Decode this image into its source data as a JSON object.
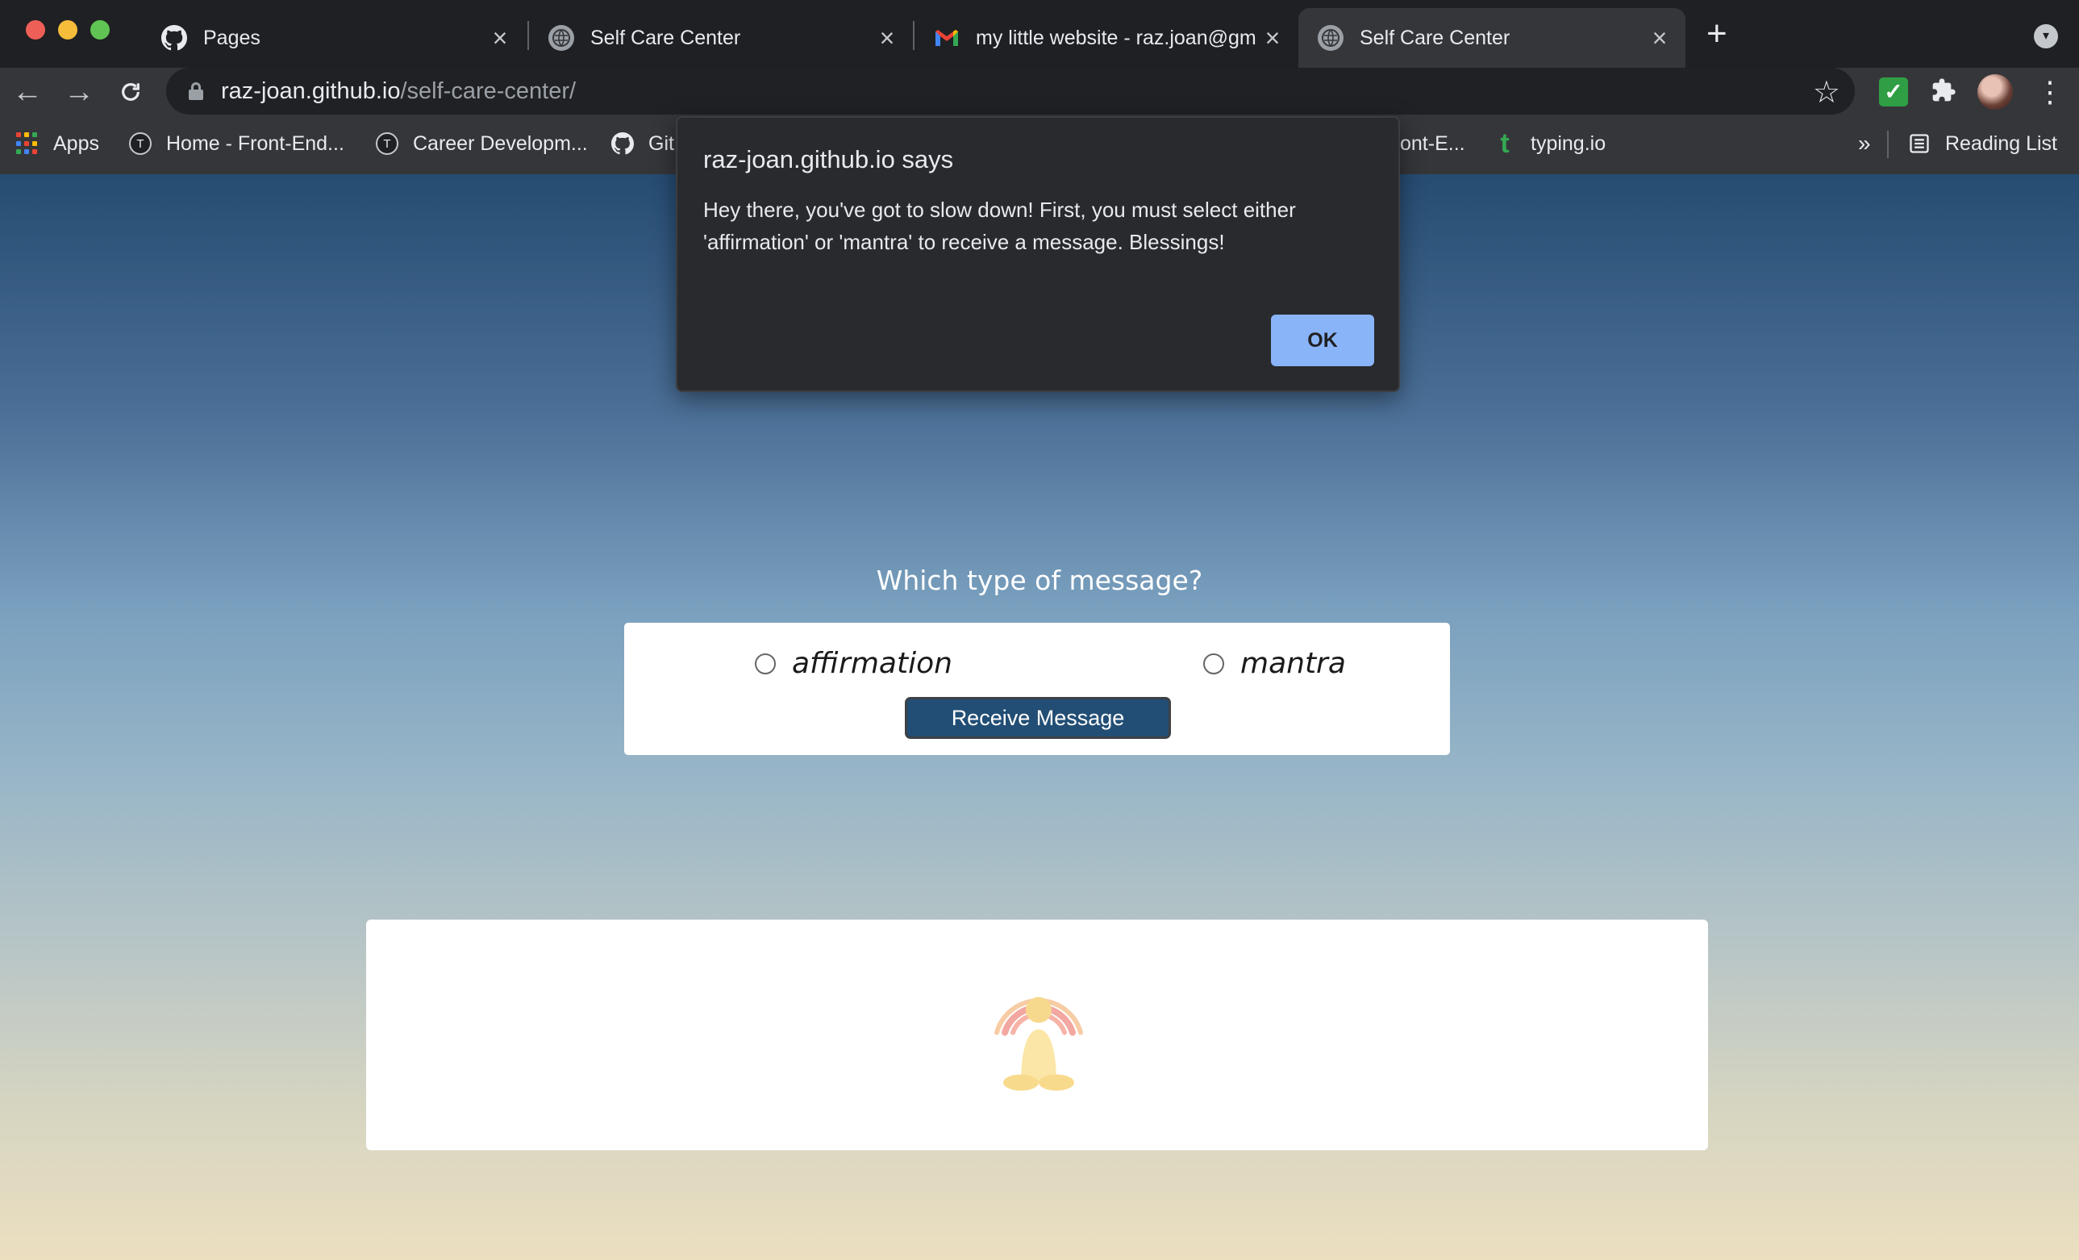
{
  "browser": {
    "tabs": [
      {
        "label": "Pages",
        "icon": "github-icon",
        "active": false
      },
      {
        "label": "Self Care Center",
        "icon": "globe-icon",
        "active": false
      },
      {
        "label": "my little website - raz.joan@gm",
        "icon": "gmail-icon",
        "active": false
      },
      {
        "label": "Self Care Center",
        "icon": "globe-icon",
        "active": true
      }
    ],
    "url_host": "raz-joan.github.io",
    "url_path": "/self-care-center/",
    "bookmarks": [
      {
        "label": "Apps",
        "icon": "apps-grid-icon"
      },
      {
        "label": "Home - Front-End...",
        "icon": "turing-icon"
      },
      {
        "label": "Career Developm...",
        "icon": "turing-icon"
      },
      {
        "label": "Git",
        "icon": "github-icon"
      },
      {
        "label": "ont-E...",
        "icon": ""
      },
      {
        "label": "typing.io",
        "icon": "typing-icon"
      }
    ],
    "overflow_label": "»",
    "reading_list_label": "Reading List"
  },
  "page": {
    "question": "Which type of message?",
    "options": [
      {
        "label": "affirmation",
        "selected": false
      },
      {
        "label": "mantra",
        "selected": false
      }
    ],
    "receive_button_label": "Receive Message",
    "message_icon": "meditation-icon"
  },
  "alert": {
    "title": "raz-joan.github.io says",
    "message": "Hey there, you've got to slow down! First, you must select either 'affirmation' or 'mantra' to receive a message. Blessings!",
    "ok_label": "OK"
  },
  "colors": {
    "button_bg": "#224e75",
    "ok_button": "#8ab4f8",
    "dialog_bg": "#292a2d"
  }
}
